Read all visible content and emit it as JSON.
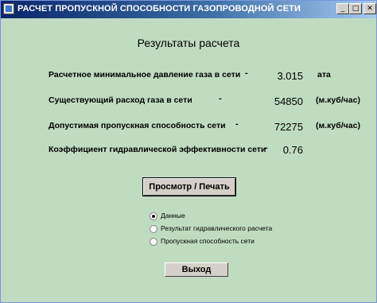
{
  "window": {
    "title": "РАСЧЕТ ПРОПУСКНОЙ СПОСОБНОСТИ  ГАЗОПРОВОДНОЙ  СЕТИ",
    "minimize_glyph": "_",
    "maximize_glyph": "□",
    "close_glyph": "✕"
  },
  "heading": "Результаты расчета",
  "results": [
    {
      "label": "Расчетное минимальное давление газа в сети",
      "dash": "-",
      "value": "3.015",
      "unit": "ата"
    },
    {
      "label": "Существующий расход газа в сети",
      "dash": "-",
      "value": "54850",
      "unit": "(м.куб/час)"
    },
    {
      "label": "Допустимая пропускная способность сети",
      "dash": "-",
      "value": "72275",
      "unit": "(м.куб/час)"
    },
    {
      "label": "Коэффициент гидравлической эффективности сети",
      "dash": "-",
      "value": "0.76",
      "unit": ""
    }
  ],
  "print_button_label": "Просмотр / Печать",
  "report_options": [
    {
      "label": "Данные",
      "selected": true
    },
    {
      "label": "Результат гидравлического расчета",
      "selected": false
    },
    {
      "label": "Пропускная способность сети",
      "selected": false
    }
  ],
  "exit_button_label": "Выход"
}
